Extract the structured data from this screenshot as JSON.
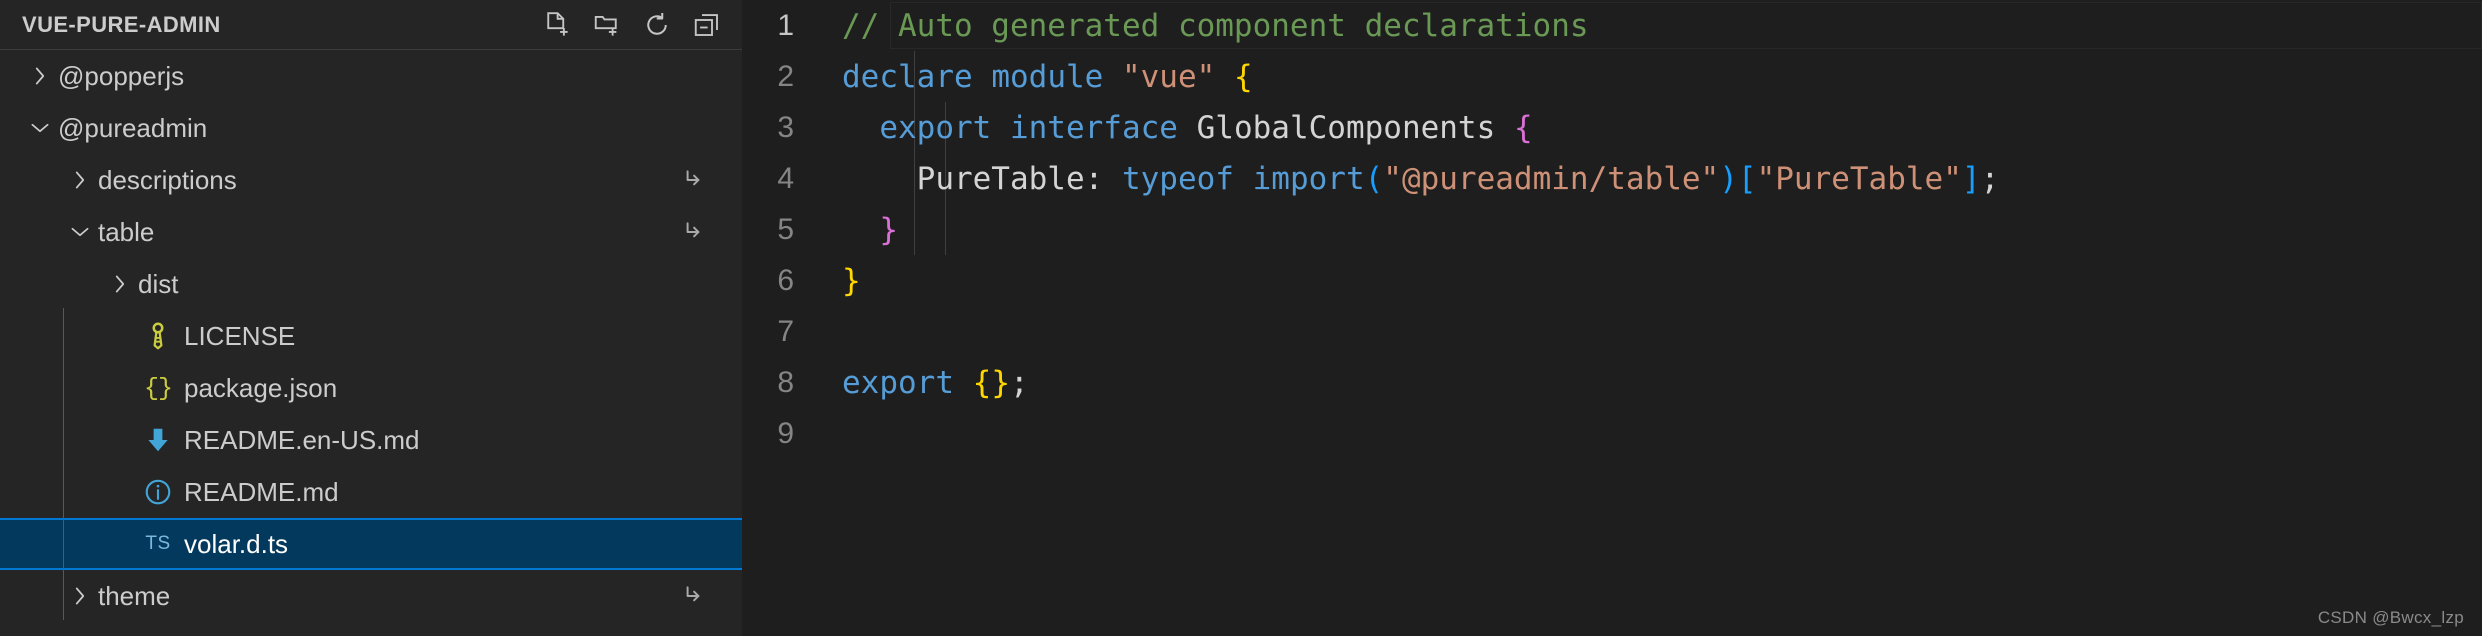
{
  "sidebar": {
    "title": "VUE-PURE-ADMIN",
    "actions": [
      {
        "name": "new-file-icon",
        "label": "New File"
      },
      {
        "name": "new-folder-icon",
        "label": "New Folder"
      },
      {
        "name": "refresh-icon",
        "label": "Refresh Explorer"
      },
      {
        "name": "collapse-all-icon",
        "label": "Collapse Folders in Explorer"
      }
    ],
    "tree": [
      {
        "label": "@popperjs",
        "kind": "folder",
        "expanded": false,
        "indent": 0,
        "icon": "chevron-right-icon",
        "symlink": false,
        "selected": false
      },
      {
        "label": "@pureadmin",
        "kind": "folder",
        "expanded": true,
        "indent": 0,
        "icon": "chevron-down-icon",
        "symlink": false,
        "selected": false
      },
      {
        "label": "descriptions",
        "kind": "folder",
        "expanded": false,
        "indent": 1,
        "icon": "chevron-right-icon",
        "symlink": true,
        "selected": false
      },
      {
        "label": "table",
        "kind": "folder",
        "expanded": true,
        "indent": 1,
        "icon": "chevron-down-icon",
        "symlink": true,
        "selected": false
      },
      {
        "label": "dist",
        "kind": "folder",
        "expanded": false,
        "indent": 2,
        "icon": "chevron-right-icon",
        "symlink": false,
        "selected": false
      },
      {
        "label": "LICENSE",
        "kind": "file",
        "expanded": null,
        "indent": 2,
        "icon": "key-icon",
        "symlink": false,
        "selected": false
      },
      {
        "label": "package.json",
        "kind": "file",
        "expanded": null,
        "indent": 2,
        "icon": "json-braces-icon",
        "symlink": false,
        "selected": false
      },
      {
        "label": "README.en-US.md",
        "kind": "file",
        "expanded": null,
        "indent": 2,
        "icon": "markdown-down-arrow-icon",
        "symlink": false,
        "selected": false
      },
      {
        "label": "README.md",
        "kind": "file",
        "expanded": null,
        "indent": 2,
        "icon": "info-circle-icon",
        "symlink": false,
        "selected": false
      },
      {
        "label": "volar.d.ts",
        "kind": "file",
        "expanded": null,
        "indent": 2,
        "icon": "typescript-icon",
        "symlink": false,
        "selected": true,
        "badge": "TS"
      },
      {
        "label": "theme",
        "kind": "folder",
        "expanded": false,
        "indent": 1,
        "icon": "chevron-right-icon",
        "symlink": true,
        "selected": false
      }
    ]
  },
  "editor": {
    "active_line": 1,
    "lines": [
      {
        "n": "1",
        "tokens": [
          {
            "t": "// Auto generated component declarations",
            "c": "c-comment"
          }
        ]
      },
      {
        "n": "2",
        "tokens": [
          {
            "t": "declare",
            "c": "c-keyword"
          },
          {
            "t": " ",
            "c": "c-plain"
          },
          {
            "t": "module",
            "c": "c-keyword"
          },
          {
            "t": " ",
            "c": "c-plain"
          },
          {
            "t": "\"vue\"",
            "c": "c-string"
          },
          {
            "t": " ",
            "c": "c-plain"
          },
          {
            "t": "{",
            "c": "br-yellow"
          }
        ]
      },
      {
        "n": "3",
        "tokens": [
          {
            "t": "  ",
            "c": "c-plain"
          },
          {
            "t": "export",
            "c": "c-keyword"
          },
          {
            "t": " ",
            "c": "c-plain"
          },
          {
            "t": "interface",
            "c": "c-keyword"
          },
          {
            "t": " ",
            "c": "c-plain"
          },
          {
            "t": "GlobalComponents",
            "c": "c-type"
          },
          {
            "t": " ",
            "c": "c-plain"
          },
          {
            "t": "{",
            "c": "br-magenta"
          }
        ]
      },
      {
        "n": "4",
        "tokens": [
          {
            "t": "    ",
            "c": "c-plain"
          },
          {
            "t": "PureTable",
            "c": "c-type"
          },
          {
            "t": ": ",
            "c": "c-punct"
          },
          {
            "t": "typeof",
            "c": "c-keyword"
          },
          {
            "t": " ",
            "c": "c-plain"
          },
          {
            "t": "import",
            "c": "c-keyword"
          },
          {
            "t": "(",
            "c": "br-blue"
          },
          {
            "t": "\"@pureadmin/table\"",
            "c": "c-string"
          },
          {
            "t": ")",
            "c": "br-blue"
          },
          {
            "t": "[",
            "c": "br-blue"
          },
          {
            "t": "\"PureTable\"",
            "c": "c-string"
          },
          {
            "t": "]",
            "c": "br-blue"
          },
          {
            "t": ";",
            "c": "c-punct"
          }
        ]
      },
      {
        "n": "5",
        "tokens": [
          {
            "t": "  ",
            "c": "c-plain"
          },
          {
            "t": "}",
            "c": "br-magenta"
          }
        ]
      },
      {
        "n": "6",
        "tokens": [
          {
            "t": "}",
            "c": "br-yellow"
          }
        ]
      },
      {
        "n": "7",
        "tokens": []
      },
      {
        "n": "8",
        "tokens": [
          {
            "t": "export",
            "c": "c-keyword"
          },
          {
            "t": " ",
            "c": "c-plain"
          },
          {
            "t": "{",
            "c": "br-yellow"
          },
          {
            "t": "}",
            "c": "br-yellow"
          },
          {
            "t": ";",
            "c": "c-punct"
          }
        ]
      },
      {
        "n": "9",
        "tokens": []
      }
    ]
  },
  "watermark": "CSDN @Bwcx_lzp",
  "colors": {
    "sidebar_bg": "#252526",
    "editor_bg": "#1e1e1e",
    "selection_bg": "#04395e",
    "selection_border": "#0078d4",
    "comment": "#6a9955",
    "keyword": "#569cd6",
    "string": "#ce9178",
    "bracket_yellow": "#ffd700",
    "bracket_magenta": "#da70d6",
    "bracket_blue": "#179fff",
    "foreground": "#d4d4d4",
    "line_number": "#858585"
  }
}
